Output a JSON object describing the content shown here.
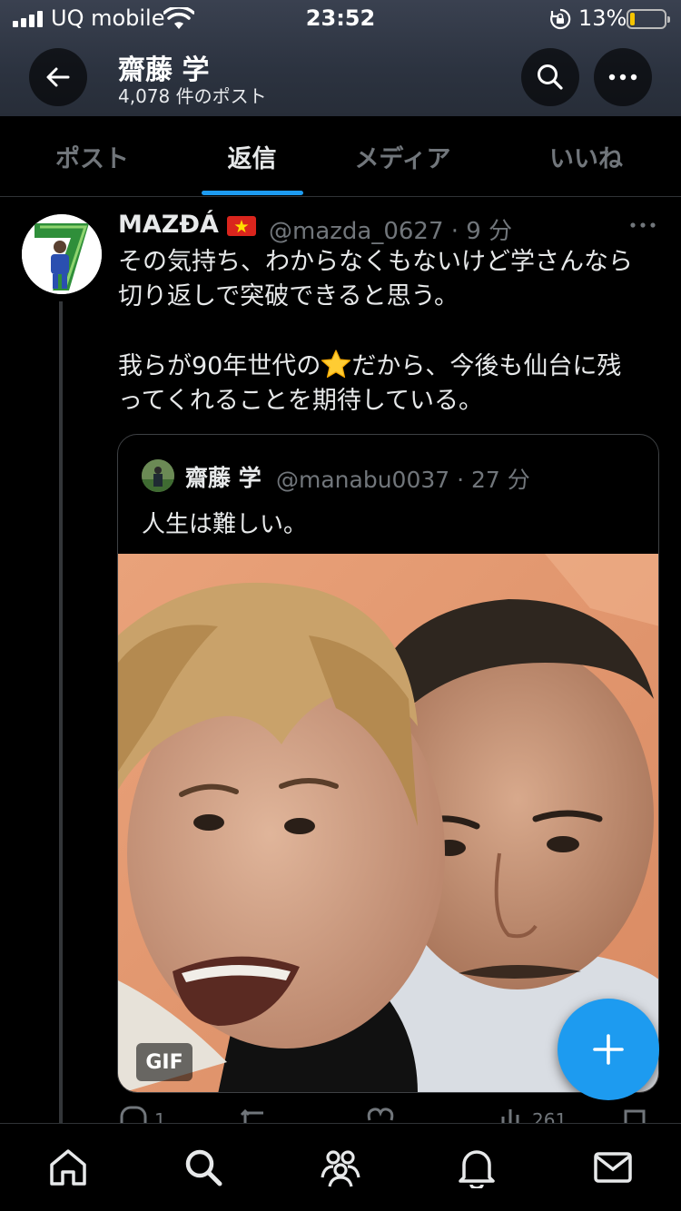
{
  "status_bar": {
    "carrier": "UQ mobile",
    "time": "23:52",
    "battery_percent": "13%",
    "battery_level": 0.13,
    "battery_color": "#f5c400"
  },
  "header": {
    "profile_name": "齋藤 学",
    "post_count": "4,078 件のポスト",
    "back_icon": "arrow-left-icon",
    "search_icon": "search-icon",
    "more_icon": "more-horizontal-icon"
  },
  "tabs": [
    {
      "label": "ポスト",
      "active": false
    },
    {
      "label": "返信",
      "active": true
    },
    {
      "label": "メディア",
      "active": false
    },
    {
      "label": "いいね",
      "active": false
    }
  ],
  "tweet": {
    "author_name": "MAZĐÁ",
    "flag": "vietnam-flag-icon",
    "handle_time": "@mazda_0627 · 9 分",
    "body_lines": [
      "その気持ち、わからなくもないけど学さんなら",
      "切り返しで突破できると思う。",
      "",
      "我らが90年世代の",
      "だから、今後も仙台に残",
      "ってくれることを期待している。"
    ],
    "emoji": "star-emoji",
    "quote": {
      "author_name": "齋藤 学",
      "handle_time": "@manabu0037 · 27 分",
      "text": "人生は難しい。",
      "media_badge": "GIF"
    },
    "actions": {
      "reply_count": "1",
      "view_count": "261"
    }
  },
  "fab": {
    "icon": "plus-icon",
    "color": "#1d9bf0"
  },
  "bottom_nav": [
    {
      "icon": "home-icon"
    },
    {
      "icon": "search-icon"
    },
    {
      "icon": "communities-icon"
    },
    {
      "icon": "bell-icon"
    },
    {
      "icon": "mail-icon"
    }
  ],
  "colors": {
    "accent": "#1d9bf0",
    "background": "#000000",
    "muted": "#71767b"
  }
}
